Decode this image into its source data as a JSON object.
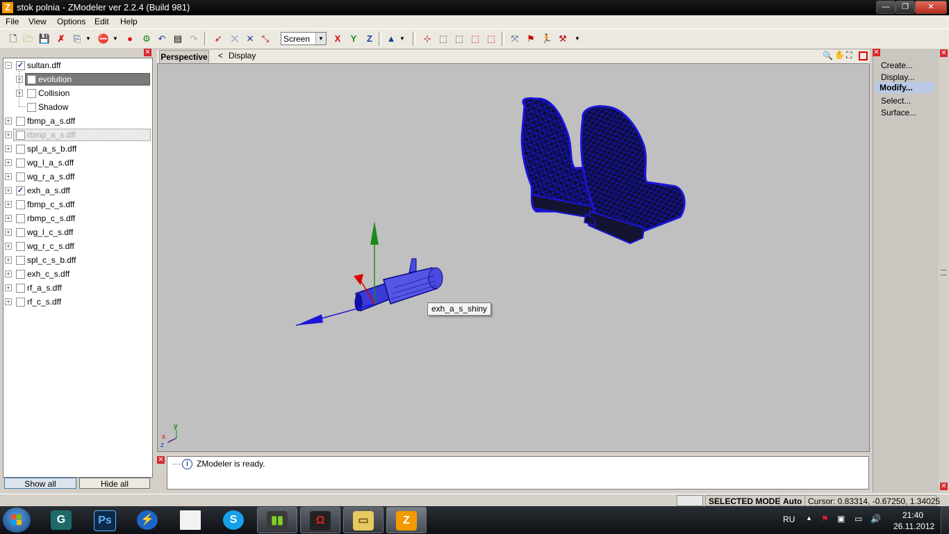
{
  "window": {
    "title": "stok polnia - ZModeler ver 2.2.4 (Build 981)",
    "app_icon": "Z"
  },
  "window_buttons": {
    "minimize": "—",
    "maximize": "❐",
    "close": "✕"
  },
  "menu": [
    "File",
    "View",
    "Options",
    "Edit",
    "Help"
  ],
  "toolbar": {
    "screen_select": "Screen",
    "x": "X",
    "y": "Y",
    "z": "Z"
  },
  "tree": {
    "items": [
      {
        "label": "sultan.dff",
        "checked": true,
        "indent": 0
      },
      {
        "label": "evolution",
        "checked": false,
        "indent": 1,
        "selected": true
      },
      {
        "label": "Collision",
        "checked": false,
        "indent": 1
      },
      {
        "label": "Shadow",
        "checked": false,
        "indent": 1
      },
      {
        "label": "fbmp_a_s.dff",
        "checked": false,
        "indent": 0
      },
      {
        "label": "rbmp_a_s.dff",
        "checked": false,
        "indent": 0,
        "disabled": true
      },
      {
        "label": "spl_a_s_b.dff",
        "checked": false,
        "indent": 0
      },
      {
        "label": "wg_l_a_s.dff",
        "checked": false,
        "indent": 0
      },
      {
        "label": "wg_r_a_s.dff",
        "checked": false,
        "indent": 0
      },
      {
        "label": "exh_a_s.dff",
        "checked": true,
        "indent": 0
      },
      {
        "label": "fbmp_c_s.dff",
        "checked": false,
        "indent": 0
      },
      {
        "label": "rbmp_c_s.dff",
        "checked": false,
        "indent": 0
      },
      {
        "label": "wg_l_c_s.dff",
        "checked": false,
        "indent": 0
      },
      {
        "label": "wg_r_c_s.dff",
        "checked": false,
        "indent": 0
      },
      {
        "label": "spl_c_s_b.dff",
        "checked": false,
        "indent": 0
      },
      {
        "label": "exh_c_s.dff",
        "checked": false,
        "indent": 0
      },
      {
        "label": "rf_a_s.dff",
        "checked": false,
        "indent": 0
      },
      {
        "label": "rf_c_s.dff",
        "checked": false,
        "indent": 0
      }
    ],
    "show_all": "Show all",
    "hide_all": "Hide all"
  },
  "viewport": {
    "tab": "Perspective",
    "breadcrumb_arrow": "<",
    "breadcrumb": "Display",
    "tooltip": "exh_a_s_shiny",
    "axis_labels": {
      "x": "x",
      "y": "y",
      "z": "z"
    }
  },
  "log": {
    "message": "ZModeler is ready."
  },
  "right_panel": [
    "Create...",
    "Display...",
    "Modify...",
    "Select...",
    "Surface..."
  ],
  "status": {
    "mode": "SELECTED MODE",
    "auto": "Auto",
    "cursor": "Cursor: 0.83314, -0.67250, 1.34025"
  },
  "taskbar": {
    "lang": "RU",
    "time": "21:40",
    "date": "26.11.2012",
    "apps": [
      "start-orb",
      "app-g",
      "photoshop",
      "speed-app",
      "document",
      "skype",
      "app-bars",
      "app-red",
      "explorer",
      "zmodeler"
    ]
  },
  "colors": {
    "mesh_blue": "#1a15d8",
    "mesh_dark": "#101040",
    "viewport_bg": "#c0c0c0",
    "accent_select": "#b9c9e6"
  }
}
